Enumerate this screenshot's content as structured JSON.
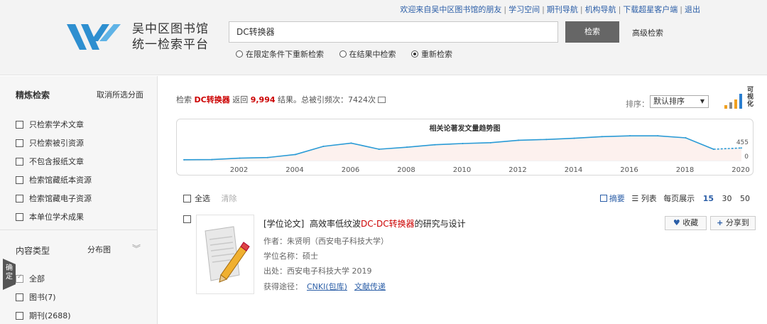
{
  "header": {
    "welcome": "欢迎来自吴中区图书馆的朋友",
    "links": [
      "学习空间",
      "期刊导航",
      "机构导航",
      "下载超星客户端",
      "退出"
    ],
    "library_name_line1": "吴中区图书馆",
    "library_name_line2": "统一检索平台",
    "search_value": "DC转换器",
    "search_button": "检索",
    "advanced_search": "高级检索",
    "radio_options": [
      {
        "label": "在限定条件下重新检索",
        "checked": false
      },
      {
        "label": "在结果中检索",
        "checked": false
      },
      {
        "label": "重新检索",
        "checked": true
      }
    ],
    "brand_color": "#2e8fd0"
  },
  "sidebar": {
    "title": "精炼检索",
    "clear_filters": "取消所选分面",
    "filters": [
      "只检索学术文章",
      "只检索被引资源",
      "不包含报纸文章",
      "检索馆藏纸本资源",
      "检索馆藏电子资源",
      "本单位学术成果"
    ],
    "content_type_title": "内容类型",
    "distribution_label": "分布图",
    "content_types": [
      {
        "label": "全部",
        "checked": true
      },
      {
        "label": "图书(7)",
        "checked": false
      },
      {
        "label": "期刊(2688)",
        "checked": false
      }
    ],
    "confirm_tab": "确定"
  },
  "results": {
    "prefix": "检索",
    "keyword": "DC转换器",
    "return_text": "返回",
    "count": "9,994",
    "suffix": "结果。总被引频次：7424次",
    "sort_label": "排序：",
    "sort_value": "默认排序",
    "viz_label": "可视化"
  },
  "chart_data": {
    "type": "line",
    "title": "相关论著发文量趋势图",
    "x": [
      2000,
      2001,
      2002,
      2003,
      2004,
      2005,
      2006,
      2007,
      2008,
      2009,
      2010,
      2011,
      2012,
      2013,
      2014,
      2015,
      2016,
      2017,
      2018,
      2019,
      2020
    ],
    "values": [
      20,
      25,
      60,
      75,
      150,
      350,
      430,
      280,
      330,
      390,
      420,
      440,
      500,
      520,
      550,
      590,
      610,
      610,
      560,
      280,
      310
    ],
    "y_labels_visible": [
      "455",
      "0"
    ],
    "xtick_labels": [
      "2002",
      "2004",
      "2006",
      "2008",
      "2010",
      "2012",
      "2014",
      "2016",
      "2018",
      "2020"
    ],
    "xlim": [
      2000,
      2020
    ],
    "ylim": [
      0,
      700
    ],
    "series_color": "#2a9bd6"
  },
  "toolbar": {
    "select_all": "全选",
    "clear": "清除",
    "view_summary": "摘要",
    "view_list": "列表",
    "per_page_label": "每页展示",
    "per_page_options": [
      "15",
      "30",
      "50"
    ],
    "per_page_selected": "15"
  },
  "item": {
    "type": "[学位论文]",
    "title_pre": "高效率低纹波",
    "title_hl": "DC-DC转换器",
    "title_post": "的研究与设计",
    "author": "作者：朱贤明（西安电子科技大学）",
    "degree": "学位名称：硕士",
    "source": "出处：西安电子科技大学 2019",
    "access_label": "获得途径：",
    "access_links": [
      "CNKI(包库)",
      "文献传递"
    ],
    "fav_button": "收藏",
    "share_button": "分享到"
  }
}
